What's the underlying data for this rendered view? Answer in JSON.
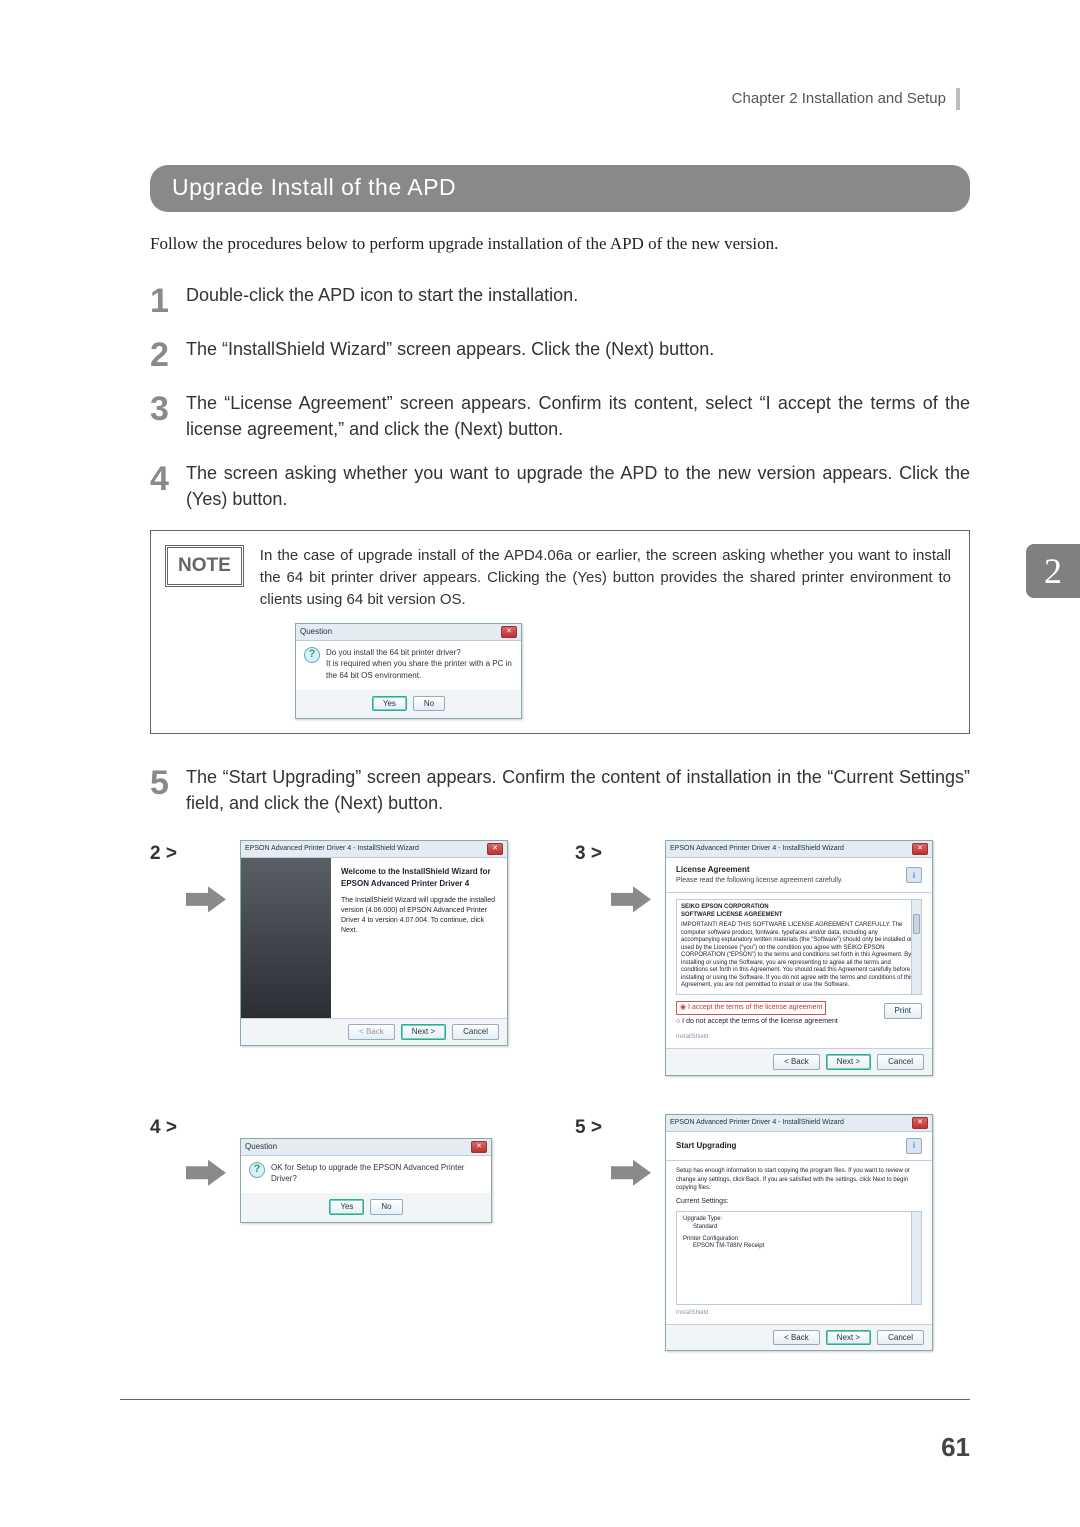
{
  "breadcrumb": "Chapter 2   Installation and Setup",
  "section_title": "Upgrade Install of the APD",
  "intro": "Follow the procedures below to perform upgrade installation of the APD of the new version.",
  "steps": {
    "s1": "Double-click the APD icon to start the installation.",
    "s2": "The “InstallShield Wizard” screen appears. Click the (Next) button.",
    "s3": "The “License Agreement” screen appears. Confirm its content, select “I accept the terms of the license agreement,” and click the (Next) button.",
    "s4": "The screen asking whether you want to upgrade the APD to the new version appears. Click the (Yes) button.",
    "s5": "The “Start Upgrading” screen appears. Confirm the content of installation in the “Current Settings” field, and click the (Next) button."
  },
  "note": {
    "badge": "NOTE",
    "text": "In the case of upgrade install of the APD4.06a or earlier, the screen asking whether you want to install the 64 bit printer driver appears. Clicking the (Yes) button provides the shared printer environment to clients using 64 bit version OS.",
    "dialog": {
      "title": "Question",
      "msg1": "Do you install the 64 bit printer driver?",
      "msg2": "It is required when you share the printer with a PC in the 64 bit OS environment.",
      "yes": "Yes",
      "no": "No"
    }
  },
  "shots": {
    "l2": "2 >",
    "l3": "3 >",
    "l4": "4 >",
    "l5": "5 >",
    "wiz_title": "EPSON Advanced Printer Driver 4 - InstallShield Wizard",
    "welcome": {
      "h": "Welcome to the InstallShield Wizard for EPSON Advanced Printer Driver 4",
      "p": "The InstallShield Wizard will upgrade the installed version (4.06.000) of EPSON Advanced Printer Driver 4 to version 4.07.004. To continue, click Next."
    },
    "license": {
      "head_t": "License Agreement",
      "head_s": "Please read the following license agreement carefully.",
      "line1": "SEIKO EPSON CORPORATION",
      "line2": "SOFTWARE LICENSE AGREEMENT",
      "body": "IMPORTANT! READ THIS SOFTWARE LICENSE AGREEMENT CAREFULLY. The computer software product, fontware, typefaces and/or data, including any accompanying explanatory written materials (the “Software”) should only be installed or used by the Licensee (“you”) on the condition you agree with SEIKO EPSON CORPORATION (“EPSON”) to the terms and conditions set forth in this Agreement. By installing or using the Software, you are representing to agree all the terms and conditions set forth in this Agreement. You should read this Agreement carefully before installing or using the Software. If you do not agree with the terms and conditions of this Agreement, you are not permitted to install or use the Software.",
      "accept": "◉ I accept the terms of the license agreement",
      "decline": "○ I do not accept the terms of the license agreement",
      "print": "Print"
    },
    "question": {
      "title": "Question",
      "msg": "OK for Setup to upgrade the EPSON Advanced Printer Driver?",
      "yes": "Yes",
      "no": "No"
    },
    "start": {
      "head_t": "Start Upgrading",
      "line1": "Setup has enough information to start copying the program files. If you want to review or change any settings, click Back. If you are satisfied with the settings, click Next to begin copying files.",
      "cs": "Current Settings:",
      "ut": "Upgrade Type:",
      "ut_v": "Standard",
      "pc": "Printer Configuration",
      "pc_v": "EPSON TM-T88IV Receipt",
      "brand": "InstallShield"
    },
    "btn_back": "< Back",
    "btn_next": "Next >",
    "btn_cancel": "Cancel"
  },
  "page_number": "61",
  "side_tab": "2"
}
